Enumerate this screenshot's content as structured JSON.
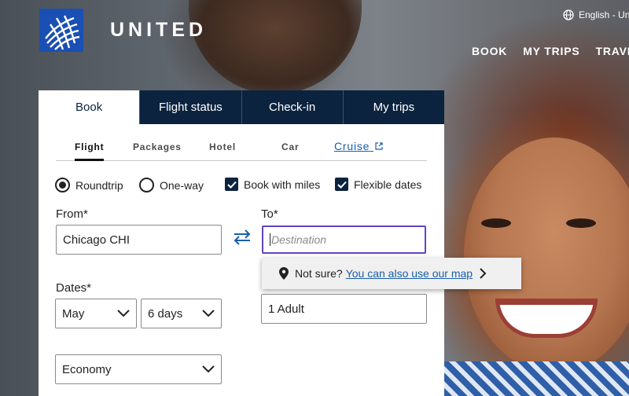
{
  "brand": {
    "name": "UNITED",
    "logo_icon": "globe-logo-icon",
    "logo_color": "#1a4fb3"
  },
  "header": {
    "language": "English - Uni",
    "nav": [
      "BOOK",
      "MY TRIPS",
      "TRAVEL"
    ]
  },
  "tabs": [
    {
      "label": "Book",
      "active": true
    },
    {
      "label": "Flight status",
      "active": false
    },
    {
      "label": "Check-in",
      "active": false
    },
    {
      "label": "My trips",
      "active": false
    }
  ],
  "subtabs": {
    "flight": "Flight",
    "packages": "Packages",
    "hotel": "Hotel",
    "car": "Car",
    "cruise": "Cruise"
  },
  "trip_options": {
    "roundtrip": {
      "label": "Roundtrip",
      "selected": true
    },
    "one_way": {
      "label": "One-way",
      "selected": false
    },
    "book_with_miles": {
      "label": "Book with miles",
      "checked": true
    },
    "flexible_dates": {
      "label": "Flexible dates",
      "checked": true
    }
  },
  "from": {
    "label": "From*",
    "value": "Chicago CHI"
  },
  "to": {
    "label": "To*",
    "placeholder": "Destination"
  },
  "map_hint": {
    "text": "Not sure?",
    "link": "You can also use our map"
  },
  "dates": {
    "label": "Dates*",
    "month": "May",
    "duration": "6 days"
  },
  "travelers": {
    "value": "1 Adult"
  },
  "cabin": {
    "value": "Economy"
  },
  "colors": {
    "navy": "#0c2340",
    "link": "#1a5ea8",
    "focus": "#6244bb"
  }
}
